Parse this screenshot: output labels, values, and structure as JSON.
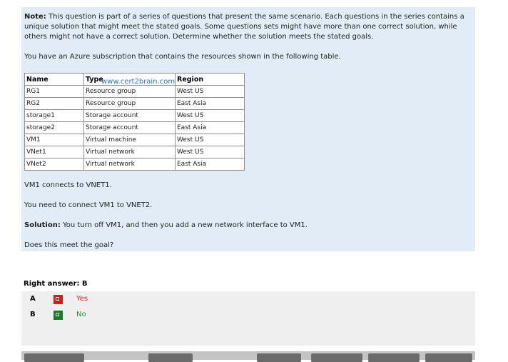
{
  "question": {
    "intro_label": "Note:",
    "intro_text": " This question is part of a series of questions that present the same scenario. Each questions in the series contains a unique solution that might meet the stated goals. Some questions sets might have more than one correct solution, while others might not have a correct solution. Determine whether the solution meets the stated goals.",
    "table_intro": "You have an Azure subscription that contains the resources shown in the following table.",
    "watermark": "www.cert2brain.com",
    "table": {
      "headers": [
        "Name",
        "Type",
        "Region"
      ],
      "rows": [
        [
          "RG1",
          "Resource group",
          "West US"
        ],
        [
          "RG2",
          "Resource group",
          "East Asia"
        ],
        [
          "storage1",
          "Storage account",
          "West US"
        ],
        [
          "storage2",
          "Storage account",
          "East Asia"
        ],
        [
          "VM1",
          "Virtual machine",
          "West US"
        ],
        [
          "VNet1",
          "Virtual network",
          "West US"
        ],
        [
          "VNet2",
          "Virtual network",
          "East Asia"
        ]
      ]
    },
    "statement1": "VM1 connects to VNET1.",
    "statement2": "You need to connect VM1 to VNET2.",
    "solution_label": "Solution:",
    "solution_text": " You turn off VM1, and then you add a new network interface to VM1.",
    "goal_question": "Does this meet the goal?"
  },
  "answer": {
    "label": "Right answer: B",
    "options": [
      {
        "letter": "A",
        "text": "Yes",
        "status": "wrong",
        "color": "#e0161b"
      },
      {
        "letter": "B",
        "text": "No",
        "status": "correct",
        "color": "#12821f"
      }
    ]
  }
}
